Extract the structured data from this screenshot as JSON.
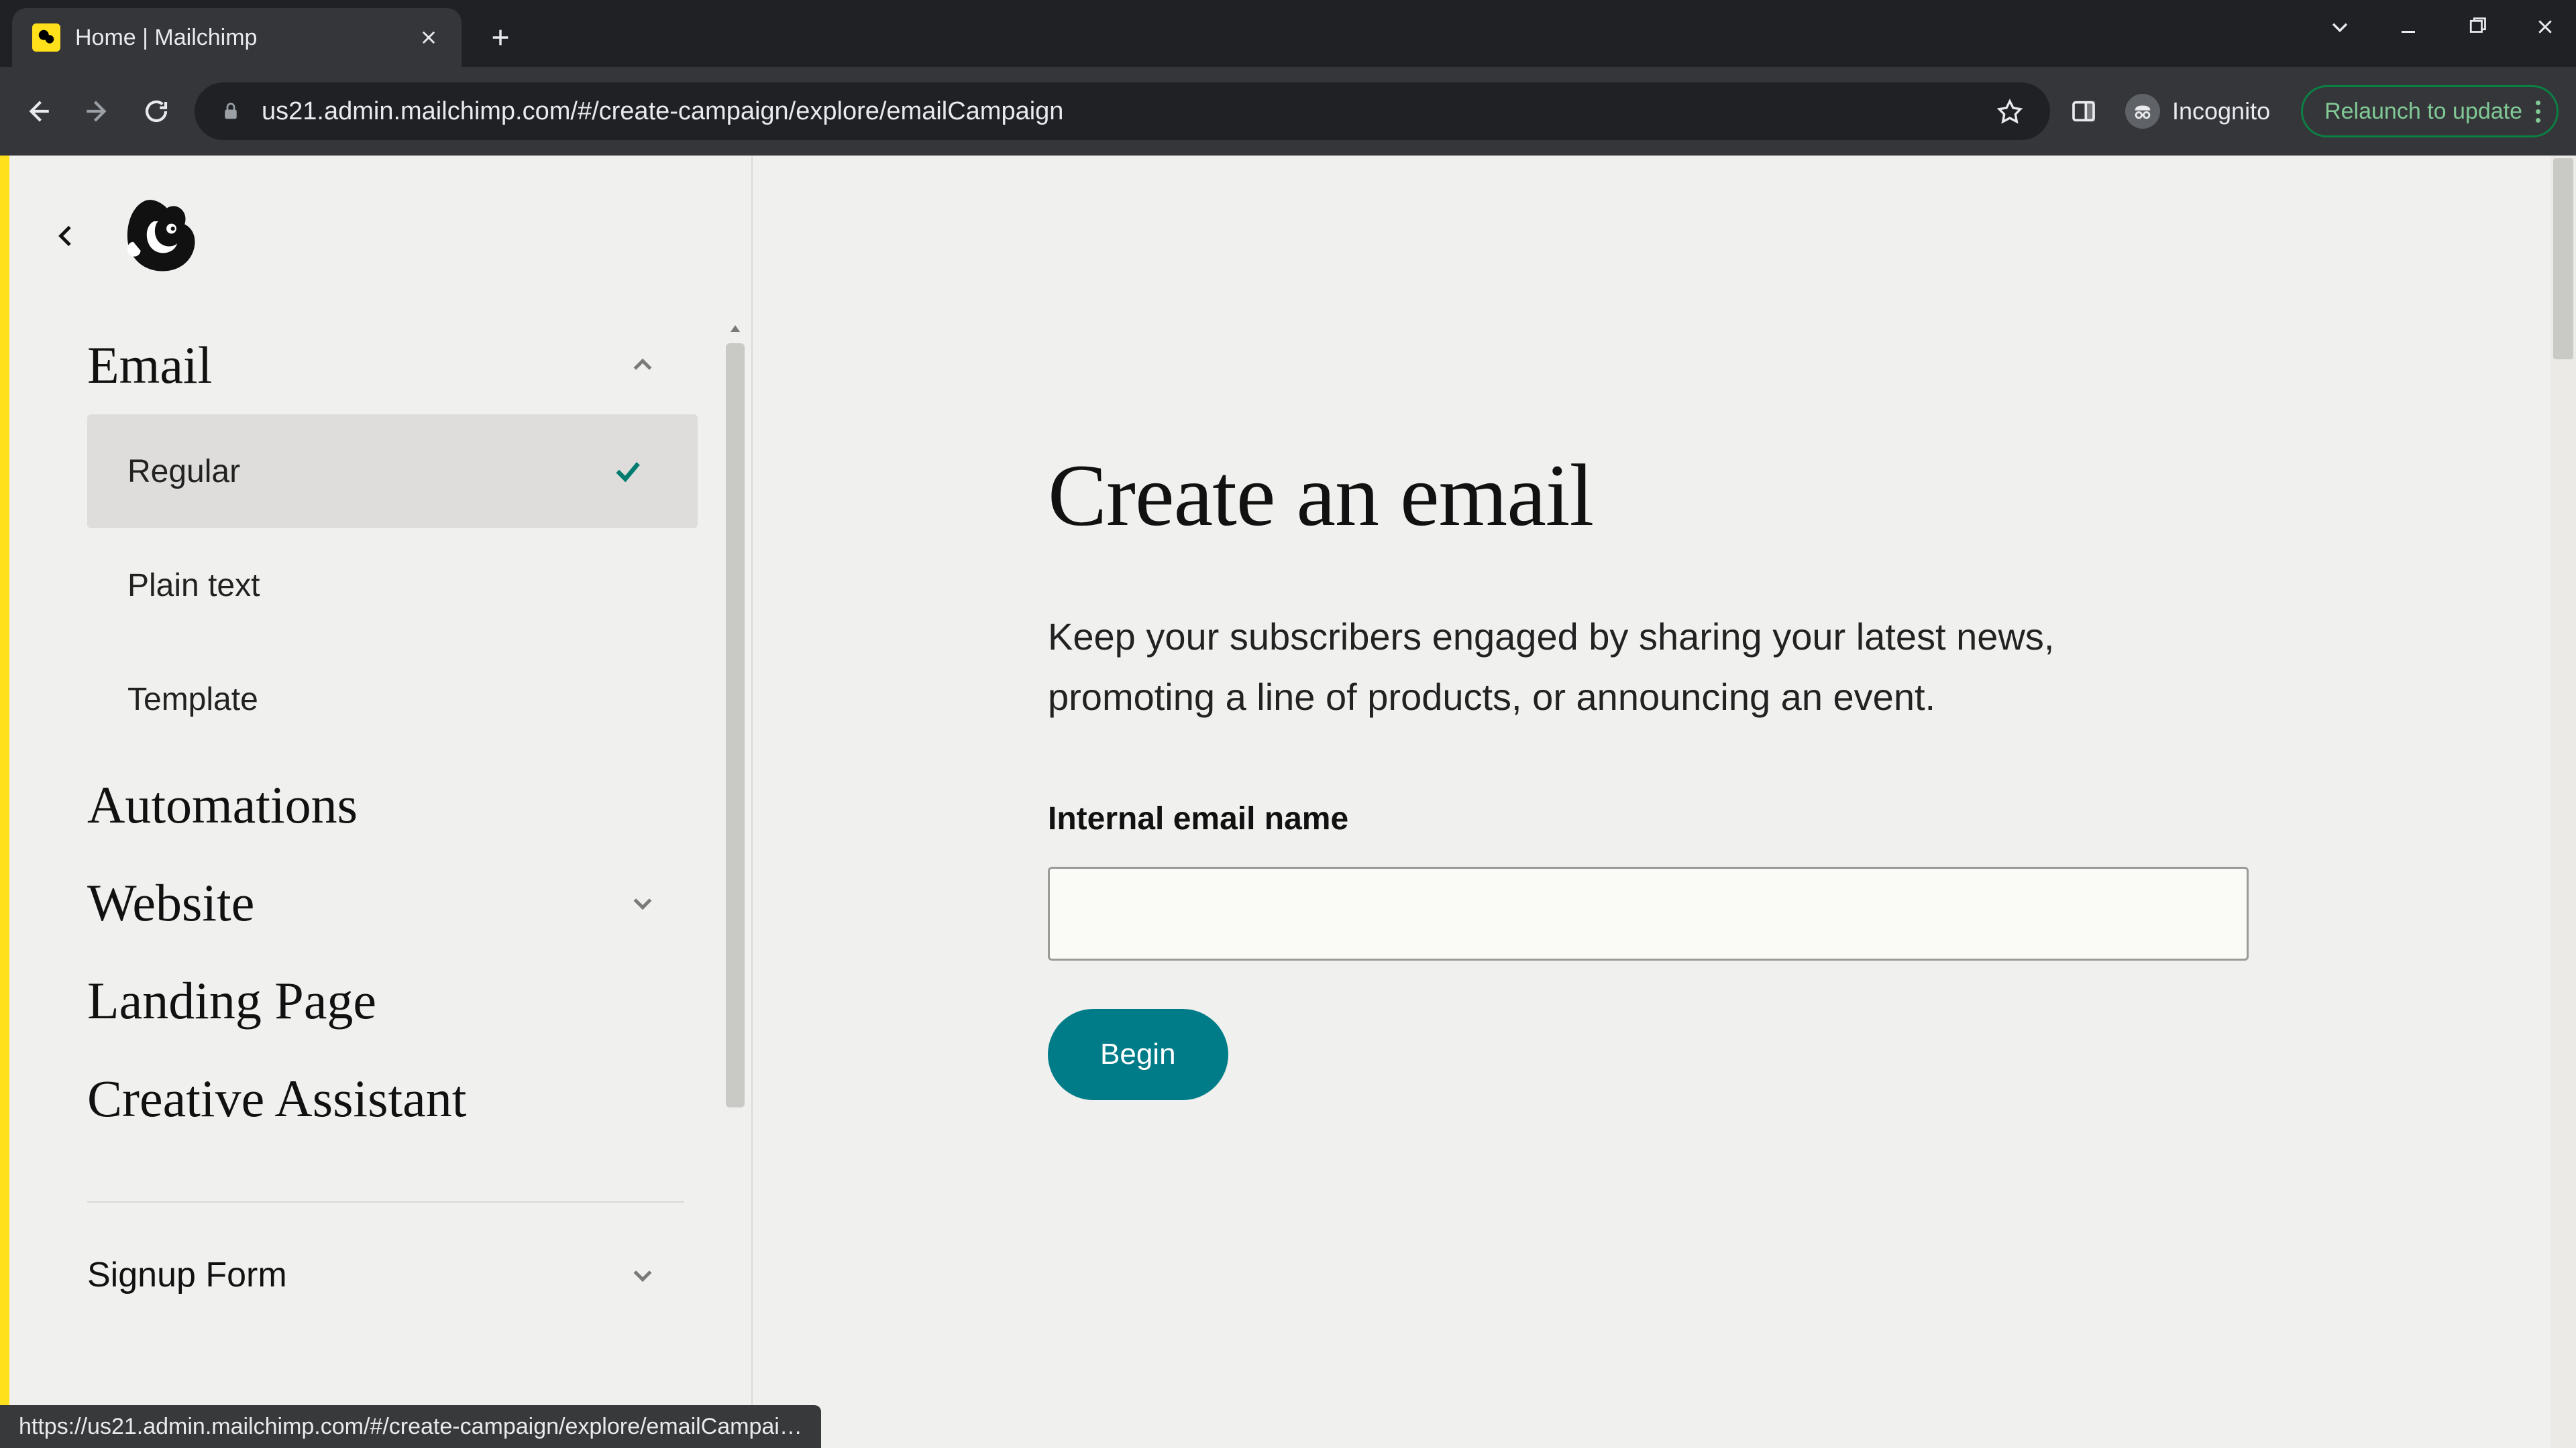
{
  "browser": {
    "tab_title": "Home | Mailchimp",
    "url": "us21.admin.mailchimp.com/#/create-campaign/explore/emailCampaign",
    "incognito_label": "Incognito",
    "relaunch_label": "Relaunch to update",
    "status_link": "https://us21.admin.mailchimp.com/#/create-campaign/explore/emailCampai…"
  },
  "sidebar": {
    "sections": {
      "email": {
        "label": "Email",
        "expanded": true,
        "items": [
          {
            "label": "Regular",
            "selected": true
          },
          {
            "label": "Plain text",
            "selected": false
          },
          {
            "label": "Template",
            "selected": false
          }
        ]
      },
      "automations": {
        "label": "Automations"
      },
      "website": {
        "label": "Website",
        "expanded": false
      },
      "landing_page": {
        "label": "Landing Page"
      },
      "creative_assistant": {
        "label": "Creative Assistant"
      },
      "signup_form": {
        "label": "Signup Form",
        "expanded": false
      }
    }
  },
  "main": {
    "headline": "Create an email",
    "subcopy": "Keep your subscribers engaged by sharing your latest news, promoting a line of products, or announcing an event.",
    "field_label": "Internal email name",
    "input_value": "",
    "input_placeholder": "",
    "begin_label": "Begin"
  },
  "colors": {
    "accent_teal": "#007c89",
    "brand_yellow": "#ffe01b",
    "check_teal": "#007c6e"
  }
}
